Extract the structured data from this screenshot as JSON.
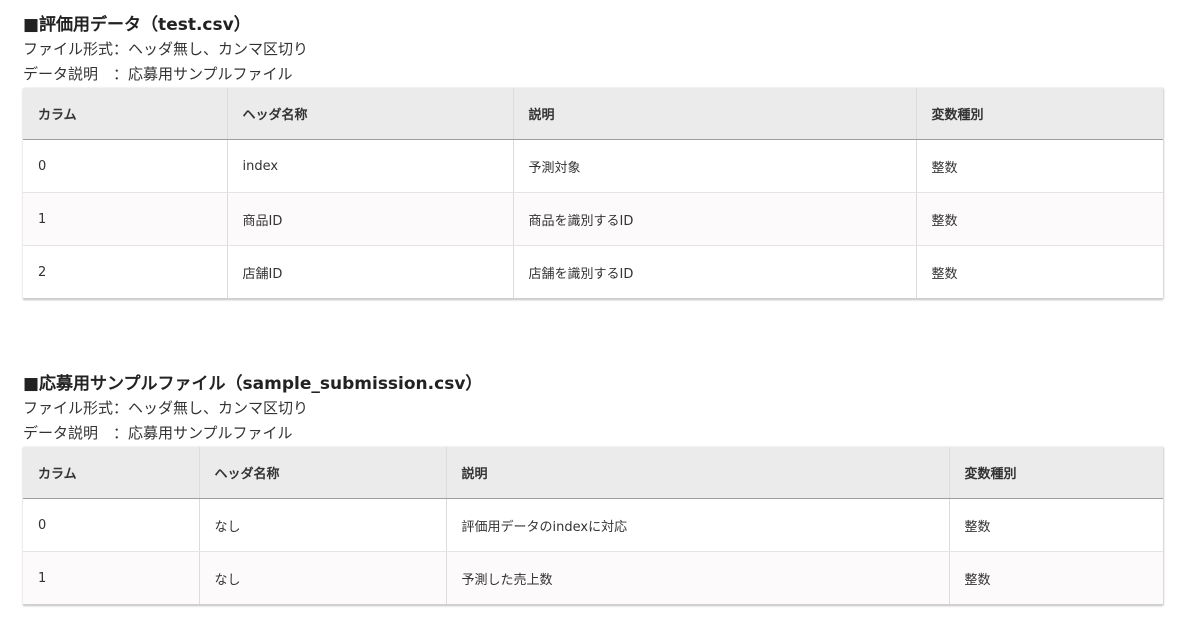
{
  "test_section": {
    "title": "■評価用データ（test.csv）",
    "file_format": "ファイル形式：ヘッダ無し、カンマ区切り",
    "description": "データ説明　：応募用サンプルファイル",
    "headers": [
      "カラム",
      "ヘッダ名称",
      "説明",
      "変数種別"
    ],
    "rows": [
      [
        "0",
        "index",
        "予測対象",
        "整数"
      ],
      [
        "1",
        "商品ID",
        "商品を識別するID",
        "整数"
      ],
      [
        "2",
        "店舗ID",
        "店舗を識別するID",
        "整数"
      ]
    ]
  },
  "submission_section": {
    "title": "■応募用サンプルファイル（sample_submission.csv）",
    "file_format": "ファイル形式：ヘッダ無し、カンマ区切り",
    "description": "データ説明　：応募用サンプルファイル",
    "headers": [
      "カラム",
      "ヘッダ名称",
      "説明",
      "変数種別"
    ],
    "rows": [
      [
        "0",
        "なし",
        "評価用データのindexに対応",
        "整数"
      ],
      [
        "1",
        "なし",
        "予測した売上数",
        "整数"
      ]
    ]
  }
}
